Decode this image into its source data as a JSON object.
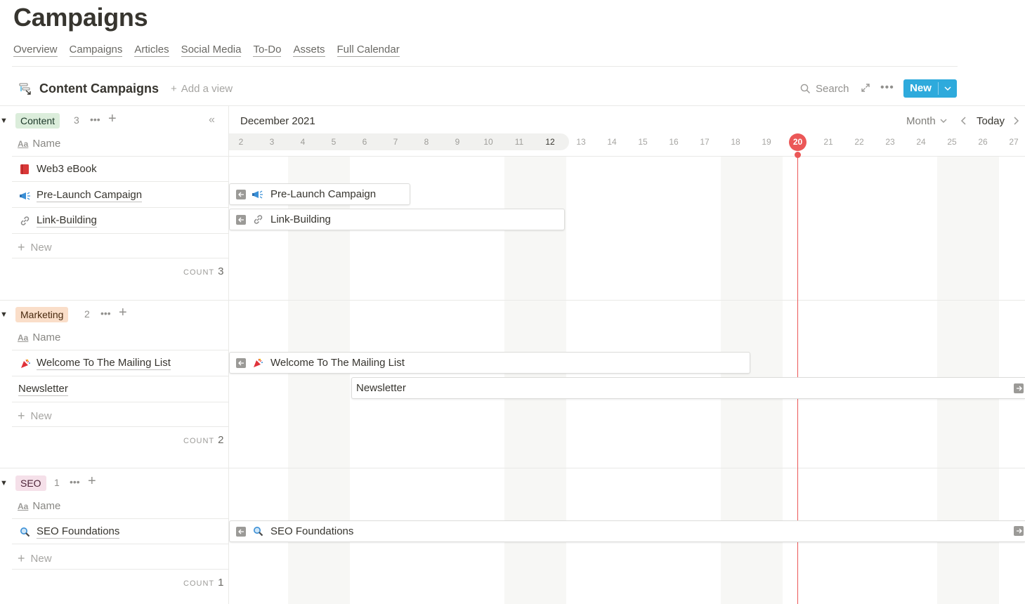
{
  "page": {
    "title": "Campaigns",
    "tabs": [
      "Overview",
      "Campaigns",
      "Articles",
      "Social Media",
      "To-Do",
      "Assets",
      "Full Calendar"
    ]
  },
  "view": {
    "icon": "timeline-icon",
    "name": "Content Campaigns",
    "add_view": "Add a view",
    "search": "Search",
    "new_button": "New"
  },
  "timeline": {
    "month_label": "December 2021",
    "zoom": "Month",
    "today_label": "Today",
    "today_day": "20",
    "days": [
      "2",
      "3",
      "4",
      "5",
      "6",
      "7",
      "8",
      "9",
      "10",
      "11",
      "12",
      "13",
      "14",
      "15",
      "16",
      "17",
      "18",
      "19",
      "20",
      "21",
      "22",
      "23",
      "24",
      "25",
      "26",
      "27"
    ]
  },
  "groups": [
    {
      "tag": "Content",
      "tag_bg": "#dbeddb",
      "tag_color": "#1c3829",
      "count": "3",
      "name_header": "Name",
      "items": [
        {
          "icon": "red-book-icon",
          "name": "Web3 eBook"
        },
        {
          "icon": "megaphone-icon",
          "name": "Pre-Launch Campaign"
        },
        {
          "icon": "link-icon",
          "name": "Link-Building"
        }
      ],
      "new_label": "New",
      "count_label": "COUNT"
    },
    {
      "tag": "Marketing",
      "tag_bg": "#fadec9",
      "tag_color": "#49290e",
      "count": "2",
      "name_header": "Name",
      "items": [
        {
          "icon": "party-popper-icon",
          "name": "Welcome To The Mailing List"
        },
        {
          "icon": "",
          "name": "Newsletter"
        }
      ],
      "new_label": "New",
      "count_label": "COUNT"
    },
    {
      "tag": "SEO",
      "tag_bg": "#f5e0e9",
      "tag_color": "#4c2337",
      "count": "1",
      "name_header": "Name",
      "items": [
        {
          "icon": "magnifier-icon",
          "name": "SEO Foundations"
        }
      ],
      "new_label": "New",
      "count_label": "COUNT"
    }
  ],
  "bars": {
    "pre_launch": "Pre-Launch Campaign",
    "link_building": "Link-Building",
    "welcome": "Welcome To The Mailing List",
    "newsletter": "Newsletter",
    "seo": "SEO Foundations"
  },
  "colors": {
    "accent": "#2eaadc",
    "today_red": "#eb5757"
  }
}
